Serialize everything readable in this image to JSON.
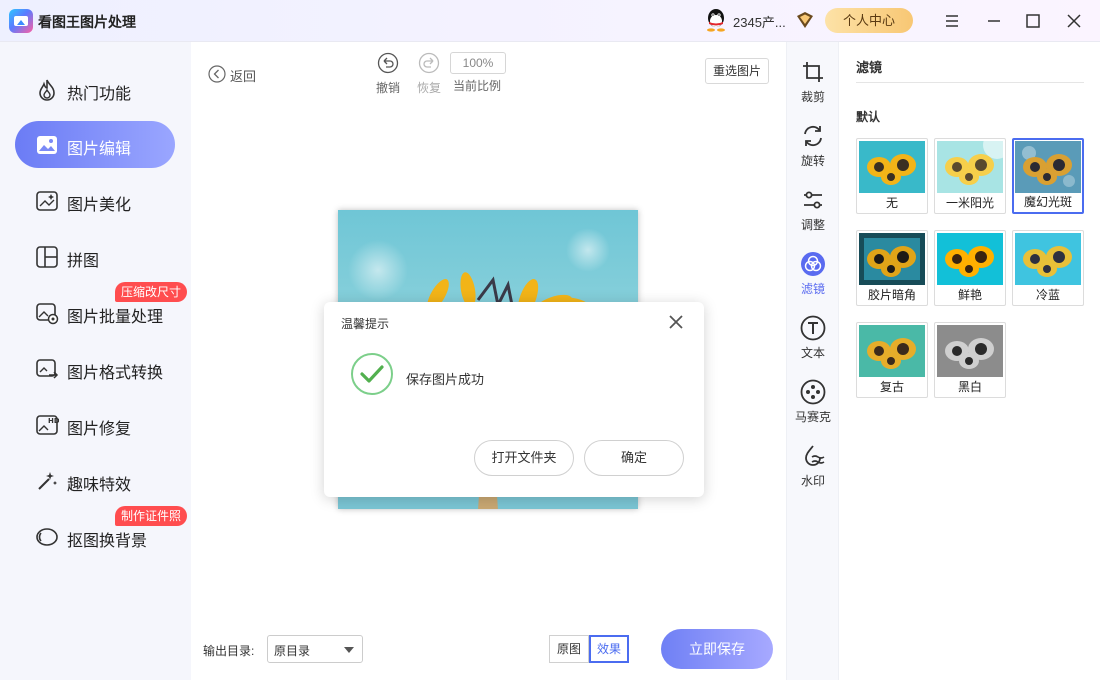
{
  "app": {
    "title": "看图王图片处理"
  },
  "header": {
    "user_name": "2345产...",
    "personal_center": "个人中心"
  },
  "sidebar": {
    "items": [
      {
        "label": "热门功能",
        "icon": "flame-icon"
      },
      {
        "label": "图片编辑",
        "icon": "image-edit-icon",
        "active": true
      },
      {
        "label": "图片美化",
        "icon": "image-beautify-icon"
      },
      {
        "label": "拼图",
        "icon": "collage-icon"
      },
      {
        "label": "图片批量处理",
        "icon": "batch-image-icon",
        "badge": "压缩改尺寸"
      },
      {
        "label": "图片格式转换",
        "icon": "format-convert-icon"
      },
      {
        "label": "图片修复",
        "icon": "hd-repair-icon"
      },
      {
        "label": "趣味特效",
        "icon": "magic-wand-icon"
      },
      {
        "label": "抠图换背景",
        "icon": "cutout-icon",
        "badge": "制作证件照"
      }
    ]
  },
  "toolbar": {
    "back": "返回",
    "undo": "撤销",
    "redo": "恢复",
    "zoom": "100%",
    "zoom_label": "当前比例",
    "reselect": "重选图片"
  },
  "footer": {
    "output_label": "输出目录:",
    "output_value": "原目录",
    "original": "原图",
    "effect": "效果",
    "save": "立即保存"
  },
  "dialog": {
    "title": "温馨提示",
    "message": "保存图片成功",
    "open_folder": "打开文件夹",
    "confirm": "确定"
  },
  "tool_rail": {
    "items": [
      {
        "label": "裁剪",
        "icon": "crop-icon"
      },
      {
        "label": "旋转",
        "icon": "rotate-icon"
      },
      {
        "label": "调整",
        "icon": "adjust-icon"
      },
      {
        "label": "滤镜",
        "icon": "filter-icon",
        "active": true
      },
      {
        "label": "文本",
        "icon": "text-icon"
      },
      {
        "label": "马赛克",
        "icon": "mosaic-icon"
      },
      {
        "label": "水印",
        "icon": "watermark-icon"
      }
    ]
  },
  "filter_panel": {
    "title": "滤镜",
    "section": "默认",
    "filters": [
      {
        "label": "无",
        "style": "normal"
      },
      {
        "label": "一米阳光",
        "style": "sunny"
      },
      {
        "label": "魔幻光斑",
        "style": "magic",
        "selected": true
      },
      {
        "label": "胶片暗角",
        "style": "vignette"
      },
      {
        "label": "鲜艳",
        "style": "vivid"
      },
      {
        "label": "冷蓝",
        "style": "cool"
      },
      {
        "label": "复古",
        "style": "retro"
      },
      {
        "label": "黑白",
        "style": "bw"
      }
    ]
  },
  "colors": {
    "accent": "#6b7cf5",
    "badge": "#ff4d4f",
    "success": "#52c41a",
    "gold": "#f8c774"
  }
}
